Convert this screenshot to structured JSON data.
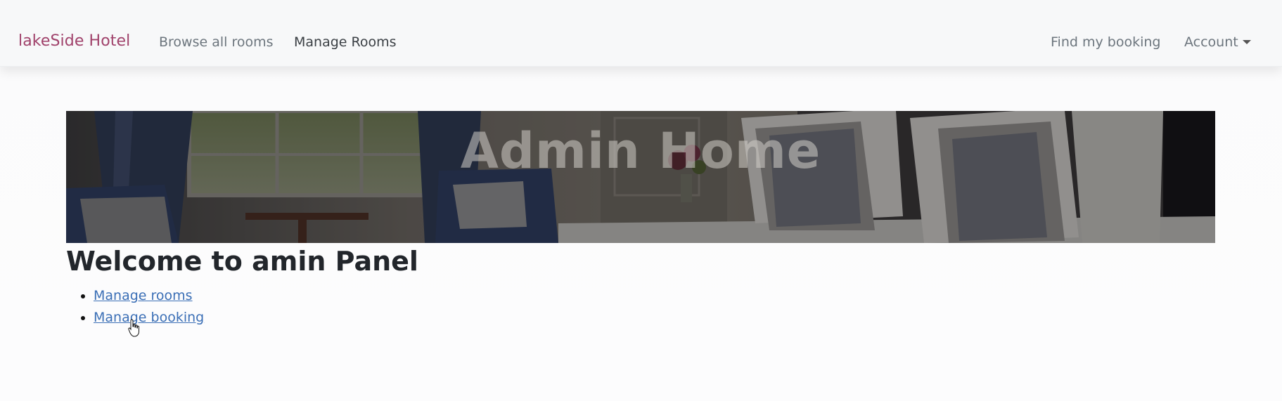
{
  "navbar": {
    "brand": "lakeSide Hotel",
    "browse_rooms": "Browse all rooms",
    "manage_rooms": "Manage Rooms",
    "find_booking": "Find my booking",
    "account": "Account"
  },
  "hero": {
    "title": "Admin Home"
  },
  "main": {
    "heading": "Welcome to amin Panel",
    "links": [
      {
        "label": "Manage rooms"
      },
      {
        "label": "Manage booking"
      }
    ]
  },
  "colors": {
    "brand": "#a0426b",
    "link": "#3b6fb6"
  },
  "icons": {
    "account_caret": "caret-down-icon",
    "pointer": "hand-cursor-icon"
  }
}
